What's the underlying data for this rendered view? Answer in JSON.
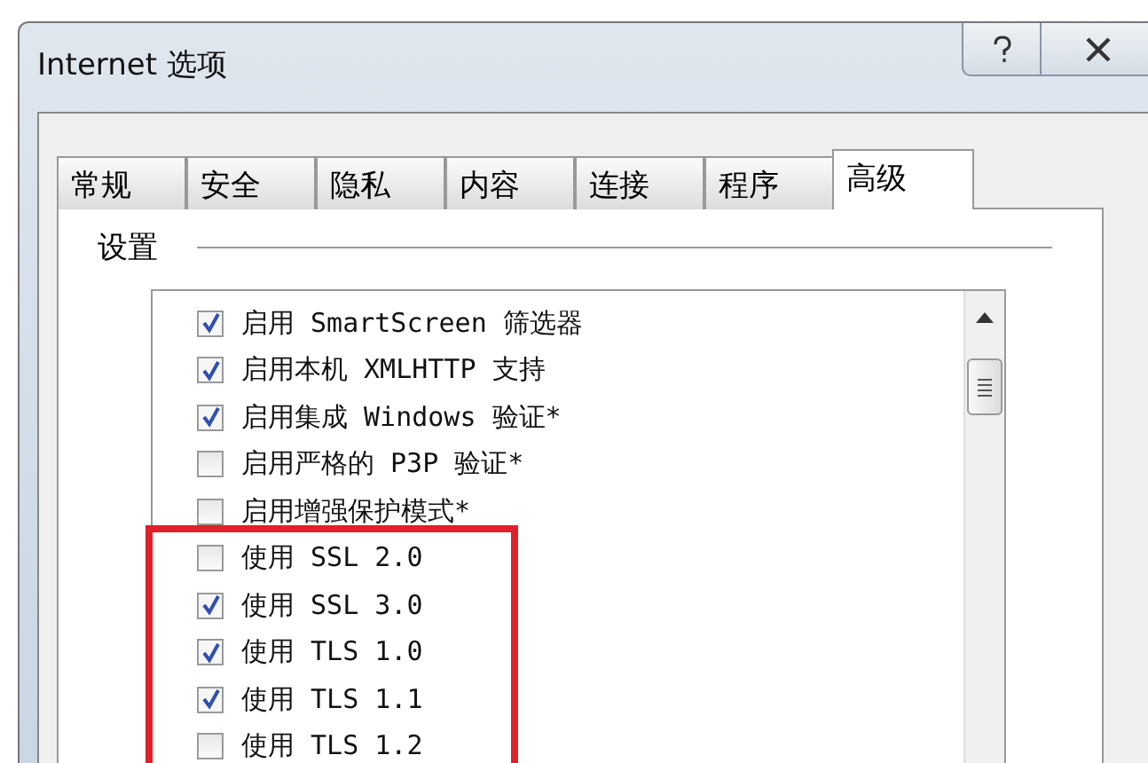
{
  "window": {
    "title": "Internet 选项"
  },
  "tabs": [
    {
      "label": "常规",
      "selected": false
    },
    {
      "label": "安全",
      "selected": false
    },
    {
      "label": "隐私",
      "selected": false
    },
    {
      "label": "内容",
      "selected": false
    },
    {
      "label": "连接",
      "selected": false
    },
    {
      "label": "程序",
      "selected": false
    },
    {
      "label": "高级",
      "selected": true
    }
  ],
  "settings": {
    "label": "设置",
    "items": [
      {
        "label": "启用 SmartScreen 筛选器",
        "checked": true
      },
      {
        "label": "启用本机 XMLHTTP 支持",
        "checked": true
      },
      {
        "label": "启用集成 Windows 验证*",
        "checked": true
      },
      {
        "label": "启用严格的 P3P 验证*",
        "checked": false
      },
      {
        "label": "启用增强保护模式*",
        "checked": false
      },
      {
        "label": "使用 SSL 2.0",
        "checked": false
      },
      {
        "label": "使用 SSL 3.0",
        "checked": true
      },
      {
        "label": "使用 TLS 1.0",
        "checked": true
      },
      {
        "label": "使用 TLS 1.1",
        "checked": true
      },
      {
        "label": "使用 TLS 1.2",
        "checked": false
      }
    ]
  }
}
